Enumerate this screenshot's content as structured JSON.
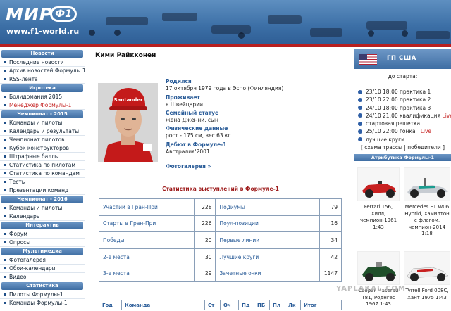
{
  "header": {
    "logo_text": "МИР",
    "logo_badge": "Ф1",
    "url": "www.f1-world.ru"
  },
  "left_sidebar": {
    "sections": [
      {
        "title": "Новости",
        "items": [
          "Последние новости",
          "Архив новостей Формулы 1",
          "RSS-лента"
        ]
      },
      {
        "title": "Игротека",
        "items": [
          "Болидомания 2015",
          "Менеджер Формулы-1"
        ]
      },
      {
        "title": "Чемпионат - 2015",
        "items": [
          "Команды и пилоты",
          "Календарь и результаты",
          "Чемпионат пилотов",
          "Кубок конструкторов",
          "Штрафные баллы",
          "Статистика по пилотам",
          "Статистика по командам",
          "Тесты",
          "Презентации команд"
        ]
      },
      {
        "title": "Чемпионат - 2016",
        "items": [
          "Команды и пилоты",
          "Календарь"
        ]
      },
      {
        "title": "Интерактив",
        "items": [
          "Форум",
          "Опросы"
        ]
      },
      {
        "title": "Мультимедиа",
        "items": [
          "Фотогалерея",
          "Обои-календари",
          "Видео"
        ]
      },
      {
        "title": "Статистика",
        "items": [
          "Пилоты Формулы-1",
          "Команды Формулы-1"
        ]
      }
    ],
    "highlight_item": "Менеджер Формулы-1"
  },
  "main": {
    "title": "Кими Райкконен",
    "bio": [
      {
        "label": "Родился",
        "value": "17 октября 1979 года в Эспо (Финляндия)"
      },
      {
        "label": "Проживает",
        "value": "в Швейцарии"
      },
      {
        "label": "Семейный статус",
        "value": "жена Дженни, сын"
      },
      {
        "label": "Физические данные",
        "value": "рост - 175 см, вес 63 кг"
      },
      {
        "label": "Дебют в Формуле-1",
        "value": "Австралия'2001"
      }
    ],
    "gallery_link": "Фотогалерея »",
    "stats_title": "Статистика выступлений в Формуле-1",
    "stats": [
      {
        "l": "Участий в Гран-При",
        "v": "228",
        "l2": "Подиумы",
        "v2": "79"
      },
      {
        "l": "Старты в Гран-При",
        "v": "226",
        "l2": "Поул-позиции",
        "v2": "16"
      },
      {
        "l": "Победы",
        "v": "20",
        "l2": "Первые линии",
        "v2": "34"
      },
      {
        "l": "2-е места",
        "v": "30",
        "l2": "Лучшие круги",
        "v2": "42"
      },
      {
        "l": "3-е места",
        "v": "29",
        "l2": "Зачетные очки",
        "v2": "1147"
      }
    ],
    "results_headers": [
      "Год",
      "Команда",
      "Ст",
      "Оч",
      "Пд",
      "ПБ",
      "Пл",
      "Лк",
      "Итог"
    ]
  },
  "right_sidebar": {
    "gp_title": "ГП США",
    "until": "до старта:",
    "schedule": [
      {
        "text": "23/10 18:00 практика 1",
        "live": ""
      },
      {
        "text": "23/10 22:00 практика 2",
        "live": ""
      },
      {
        "text": "24/10 18:00 практика 3",
        "live": ""
      },
      {
        "text": "24/10 21:00 квалификация",
        "live": "Live"
      },
      {
        "text": "стартовая решетка",
        "live": ""
      },
      {
        "text": "25/10 22:00 гонка",
        "live": "Live"
      },
      {
        "text": "лучшие круги",
        "live": ""
      }
    ],
    "links": "[ схема трассы | победители ]",
    "attr_title": "Атрибутика Формулы-1",
    "models": [
      {
        "caption": "Ferrari 156, Хилл, чемпион-1961 1:43"
      },
      {
        "caption": "Mercedes F1 W06 Hybrid, Хэмилтон с флагом, чемпион-2014 1:18"
      },
      {
        "caption": "Cooper Maserati T81, Роднгес 1967 1:43"
      },
      {
        "caption": "Tyrrell Ford 008C, Хант 1975 1:43"
      }
    ],
    "colors": {
      "accent": "#3f6ea3",
      "live": "#c4201f",
      "header_red": "#b81f1f"
    }
  },
  "watermark": "YAPLAKAL.COM"
}
